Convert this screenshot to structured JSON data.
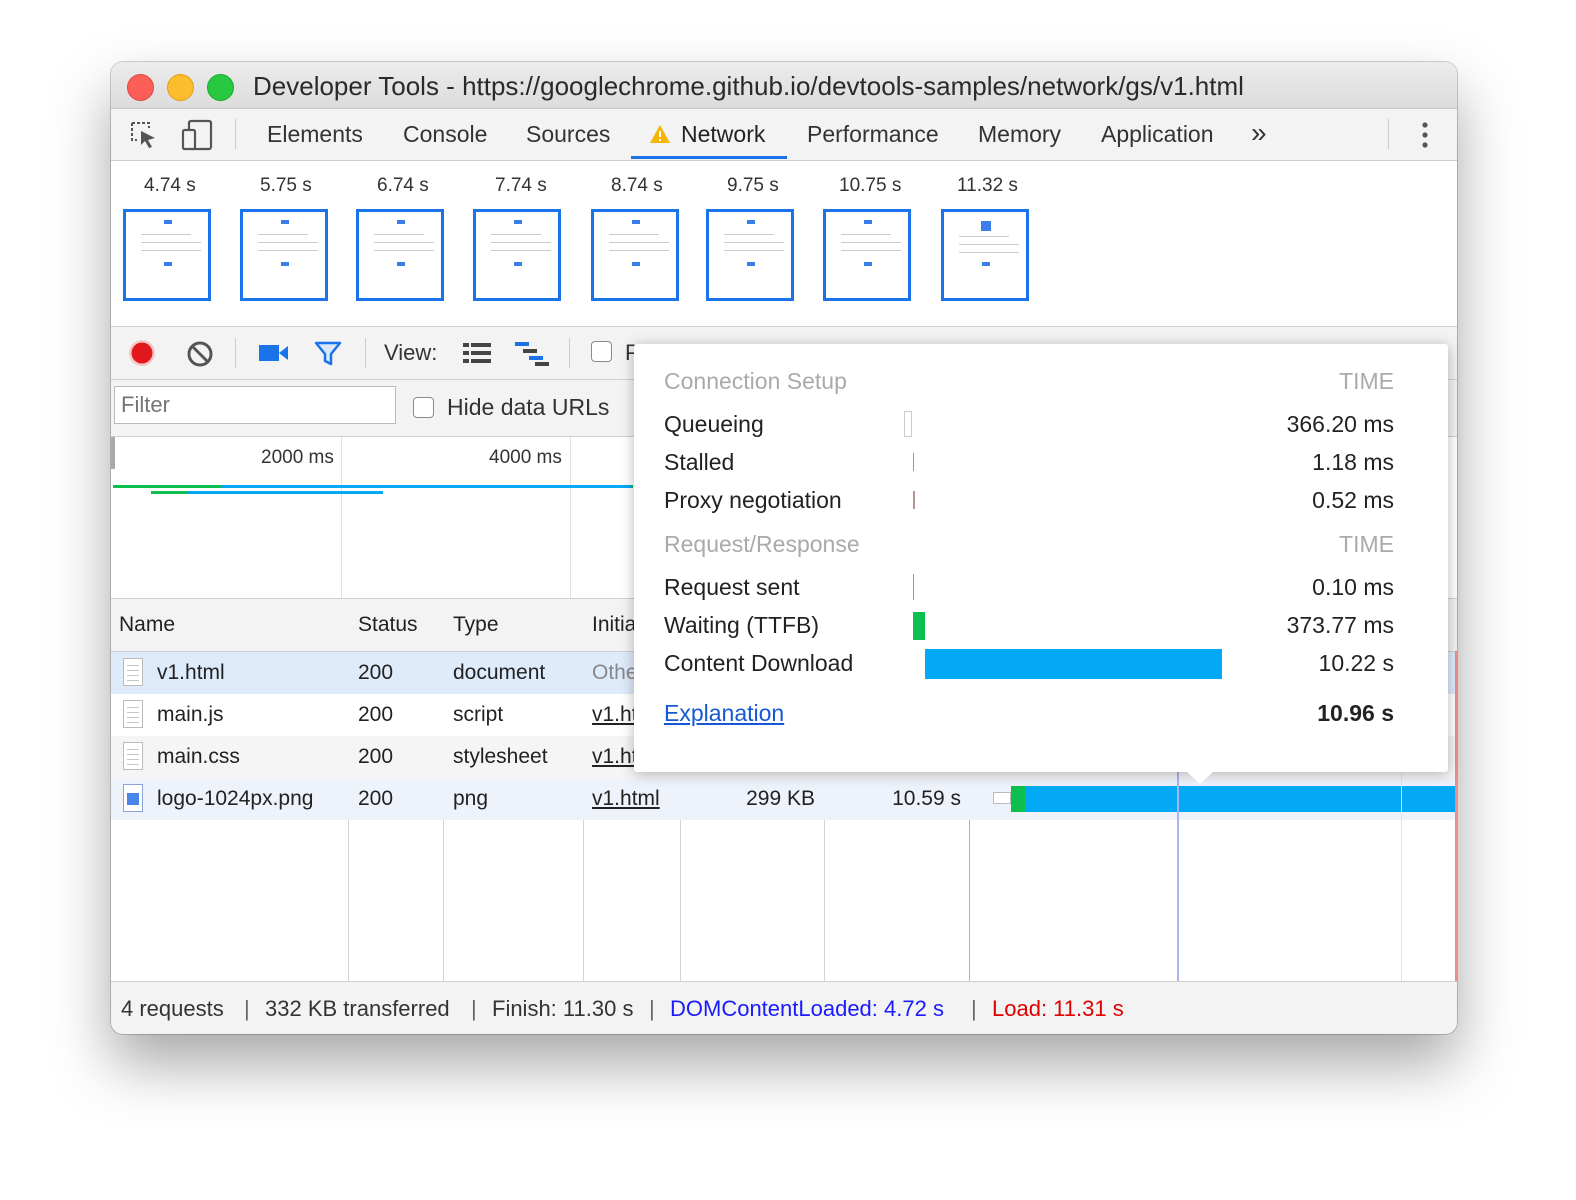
{
  "window": {
    "title": "Developer Tools - https://googlechrome.github.io/devtools-samples/network/gs/v1.html"
  },
  "tabs": [
    "Elements",
    "Console",
    "Sources",
    "Network",
    "Performance",
    "Memory",
    "Application"
  ],
  "tabs_more": "»",
  "active_tab": "Network",
  "filmstrip": {
    "times": [
      "4.74 s",
      "5.75 s",
      "6.74 s",
      "7.74 s",
      "8.74 s",
      "9.75 s",
      "10.75 s",
      "11.32 s"
    ]
  },
  "toolbar": {
    "view_label": "View:",
    "partial_label": "P"
  },
  "filter": {
    "placeholder": "Filter",
    "hide_data_urls": "Hide data URLs"
  },
  "overview": {
    "ticks": [
      "2000 ms",
      "4000 ms"
    ]
  },
  "table": {
    "headers": [
      "Name",
      "Status",
      "Type",
      "Initia"
    ],
    "rows": [
      {
        "name": "v1.html",
        "status": "200",
        "type": "document",
        "initiator": "Othe",
        "size": "",
        "time": ""
      },
      {
        "name": "main.js",
        "status": "200",
        "type": "script",
        "initiator": "v1.ht",
        "size": "",
        "time": ""
      },
      {
        "name": "main.css",
        "status": "200",
        "type": "stylesheet",
        "initiator": "v1.ht",
        "size": "",
        "time": ""
      },
      {
        "name": "logo-1024px.png",
        "status": "200",
        "type": "png",
        "initiator": "v1.html",
        "size": "299 KB",
        "time": "10.59 s"
      }
    ]
  },
  "status_bar": {
    "requests": "4 requests",
    "transferred": "332 KB transferred",
    "finish": "Finish: 11.30 s",
    "dom_content_loaded": "DOMContentLoaded: 4.72 s",
    "load": "Load: 11.31 s",
    "dcl_color": "#1a1aff",
    "load_color": "#e00000"
  },
  "timing_popover": {
    "connection_header": "Connection Setup",
    "time_header": "TIME",
    "queueing": {
      "label": "Queueing",
      "time": "366.20 ms"
    },
    "stalled": {
      "label": "Stalled",
      "time": "1.18 ms"
    },
    "proxy": {
      "label": "Proxy negotiation",
      "time": "0.52 ms"
    },
    "request_header": "Request/Response",
    "request_sent": {
      "label": "Request sent",
      "time": "0.10 ms"
    },
    "waiting": {
      "label": "Waiting (TTFB)",
      "time": "373.77 ms"
    },
    "download": {
      "label": "Content Download",
      "time": "10.22 s"
    },
    "explanation": "Explanation",
    "total": "10.96 s",
    "ttfb_color": "#0cbf4e",
    "download_color": "#03a9f4"
  }
}
